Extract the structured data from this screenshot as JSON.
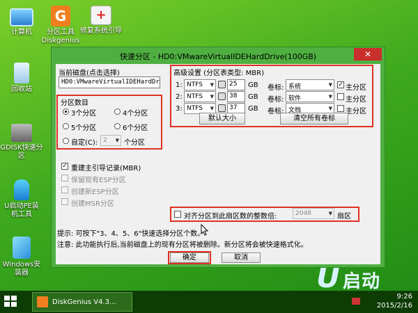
{
  "desktop": {
    "icons": [
      {
        "label": "计算机",
        "icon": "computer-icon"
      },
      {
        "label": "回收站",
        "icon": "recycle-bin-icon"
      },
      {
        "label": "GDISK快速分区",
        "icon": "gdisk-icon"
      },
      {
        "label": "U启动PE装机工具",
        "icon": "pe-install-icon"
      },
      {
        "label": "Windows安装器",
        "icon": "windows-installer-icon"
      },
      {
        "label": "分区工具Diskgenius",
        "icon": "diskgenius-icon"
      },
      {
        "label": "修复系统引导",
        "icon": "repair-boot-icon"
      }
    ],
    "logo_text": "启动"
  },
  "taskbar": {
    "app_label": "DiskGenius V4.3...",
    "time": "9:26",
    "date": "2015/2/16"
  },
  "dialog": {
    "title": "快速分区 - HD0:VMwareVirtualIDEHardDrive(100GB)",
    "close_glyph": "✕",
    "current_disk_label": "当前磁盘(点击选择)",
    "current_disk_value": "HD0:VMwareVirtualIDEHardDri",
    "partition_count_label": "分区数目",
    "options": [
      "3个分区",
      "4个分区",
      "5个分区",
      "6个分区"
    ],
    "selected_option": "3个分区",
    "custom_label": "自定(C):",
    "custom_value": "2",
    "custom_unit": "个分区",
    "rebuild_mbr_label": "重建主引导记录(MBR)",
    "keep_esp_label": "保留现有ESP分区",
    "create_esp_label": "创建新ESP分区",
    "create_msr_label": "创建MSR分区",
    "advanced_label": "高级设置 (分区表类型: MBR)",
    "partitions": [
      {
        "index": "1:",
        "fs": "NTFS",
        "size": "25",
        "unit": "GB",
        "vol_label": "卷标:",
        "name": "系统",
        "primary": true
      },
      {
        "index": "2:",
        "fs": "NTFS",
        "size": "38",
        "unit": "GB",
        "vol_label": "卷标:",
        "name": "软件",
        "primary": false
      },
      {
        "index": "3:",
        "fs": "NTFS",
        "size": "37",
        "unit": "GB",
        "vol_label": "卷标:",
        "name": "文档",
        "primary": false
      }
    ],
    "primary_label": "主分区",
    "default_size_button": "默认大小",
    "clear_labels_button": "清空所有卷标",
    "align_label": "对齐分区到此扇区数的整数倍:",
    "align_value": "2048",
    "align_unit": "扇区",
    "hint_text": "提示: 可按下\"3、4、5、6\"快速选择分区个数。",
    "notice_text": "注意: 此功能执行后,当前磁盘上的现有分区将被删除。新分区将会被快速格式化。",
    "ok_button": "确定",
    "cancel_button": "取消"
  },
  "colors": {
    "highlight_red": "#e03020",
    "dialog_frame": "#4fb041"
  }
}
